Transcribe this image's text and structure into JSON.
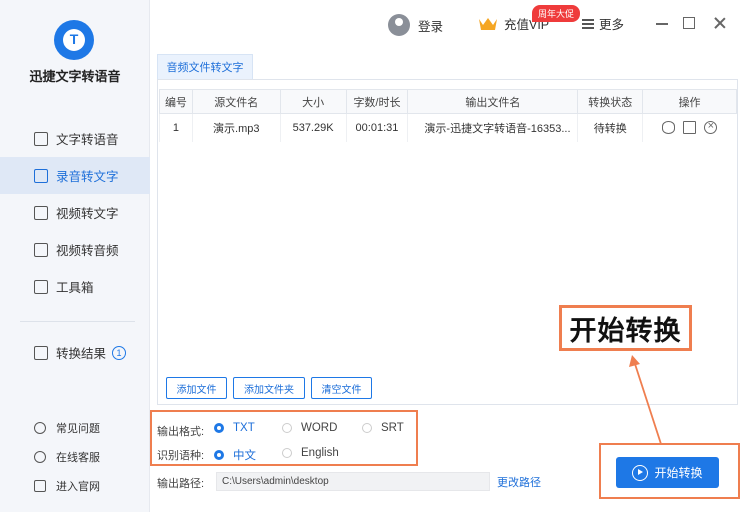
{
  "app": {
    "name": "迅捷文字转语音"
  },
  "sidebar": {
    "items": [
      {
        "label": "文字转语音",
        "icon": "text-to-speech-icon"
      },
      {
        "label": "录音转文字",
        "icon": "audio-to-text-icon",
        "active": true
      },
      {
        "label": "视频转文字",
        "icon": "video-to-text-icon"
      },
      {
        "label": "视频转音频",
        "icon": "video-to-audio-icon"
      },
      {
        "label": "工具箱",
        "icon": "toolbox-icon"
      }
    ],
    "result_label": "转换结果",
    "result_count": "1",
    "bottom": [
      {
        "label": "常见问题",
        "icon": "help-icon"
      },
      {
        "label": "在线客服",
        "icon": "headset-icon"
      },
      {
        "label": "进入官网",
        "icon": "monitor-icon"
      }
    ]
  },
  "topbar": {
    "login": "登录",
    "vip": "充值VIP",
    "promo": "周年大促",
    "more": "更多"
  },
  "tab": {
    "label": "音频文件转文字"
  },
  "table": {
    "headers": [
      "编号",
      "源文件名",
      "大小",
      "字数/时长",
      "输出文件名",
      "转换状态",
      "操作"
    ],
    "rows": [
      [
        "1",
        "演示.mp3",
        "537.29K",
        "00:01:31",
        "演示-迅捷文字转语音-16353...",
        "待转换"
      ]
    ]
  },
  "buttons": {
    "add_file": "添加文件",
    "add_folder": "添加文件夹",
    "clear": "清空文件"
  },
  "options": {
    "format_label": "输出格式:",
    "formats": [
      "TXT",
      "WORD",
      "SRT"
    ],
    "selected_format": "TXT",
    "lang_label": "识别语种:",
    "langs": [
      "中文",
      "English"
    ],
    "selected_lang": "中文"
  },
  "output": {
    "label": "输出路径:",
    "path": "C:\\Users\\admin\\desktop",
    "change": "更改路径"
  },
  "start": {
    "label": "开始转换"
  },
  "callout": {
    "text": "开始转换"
  },
  "colors": {
    "accent": "#1e78e6",
    "highlight": "#ef7e4f",
    "promo": "#ef3b3b"
  }
}
